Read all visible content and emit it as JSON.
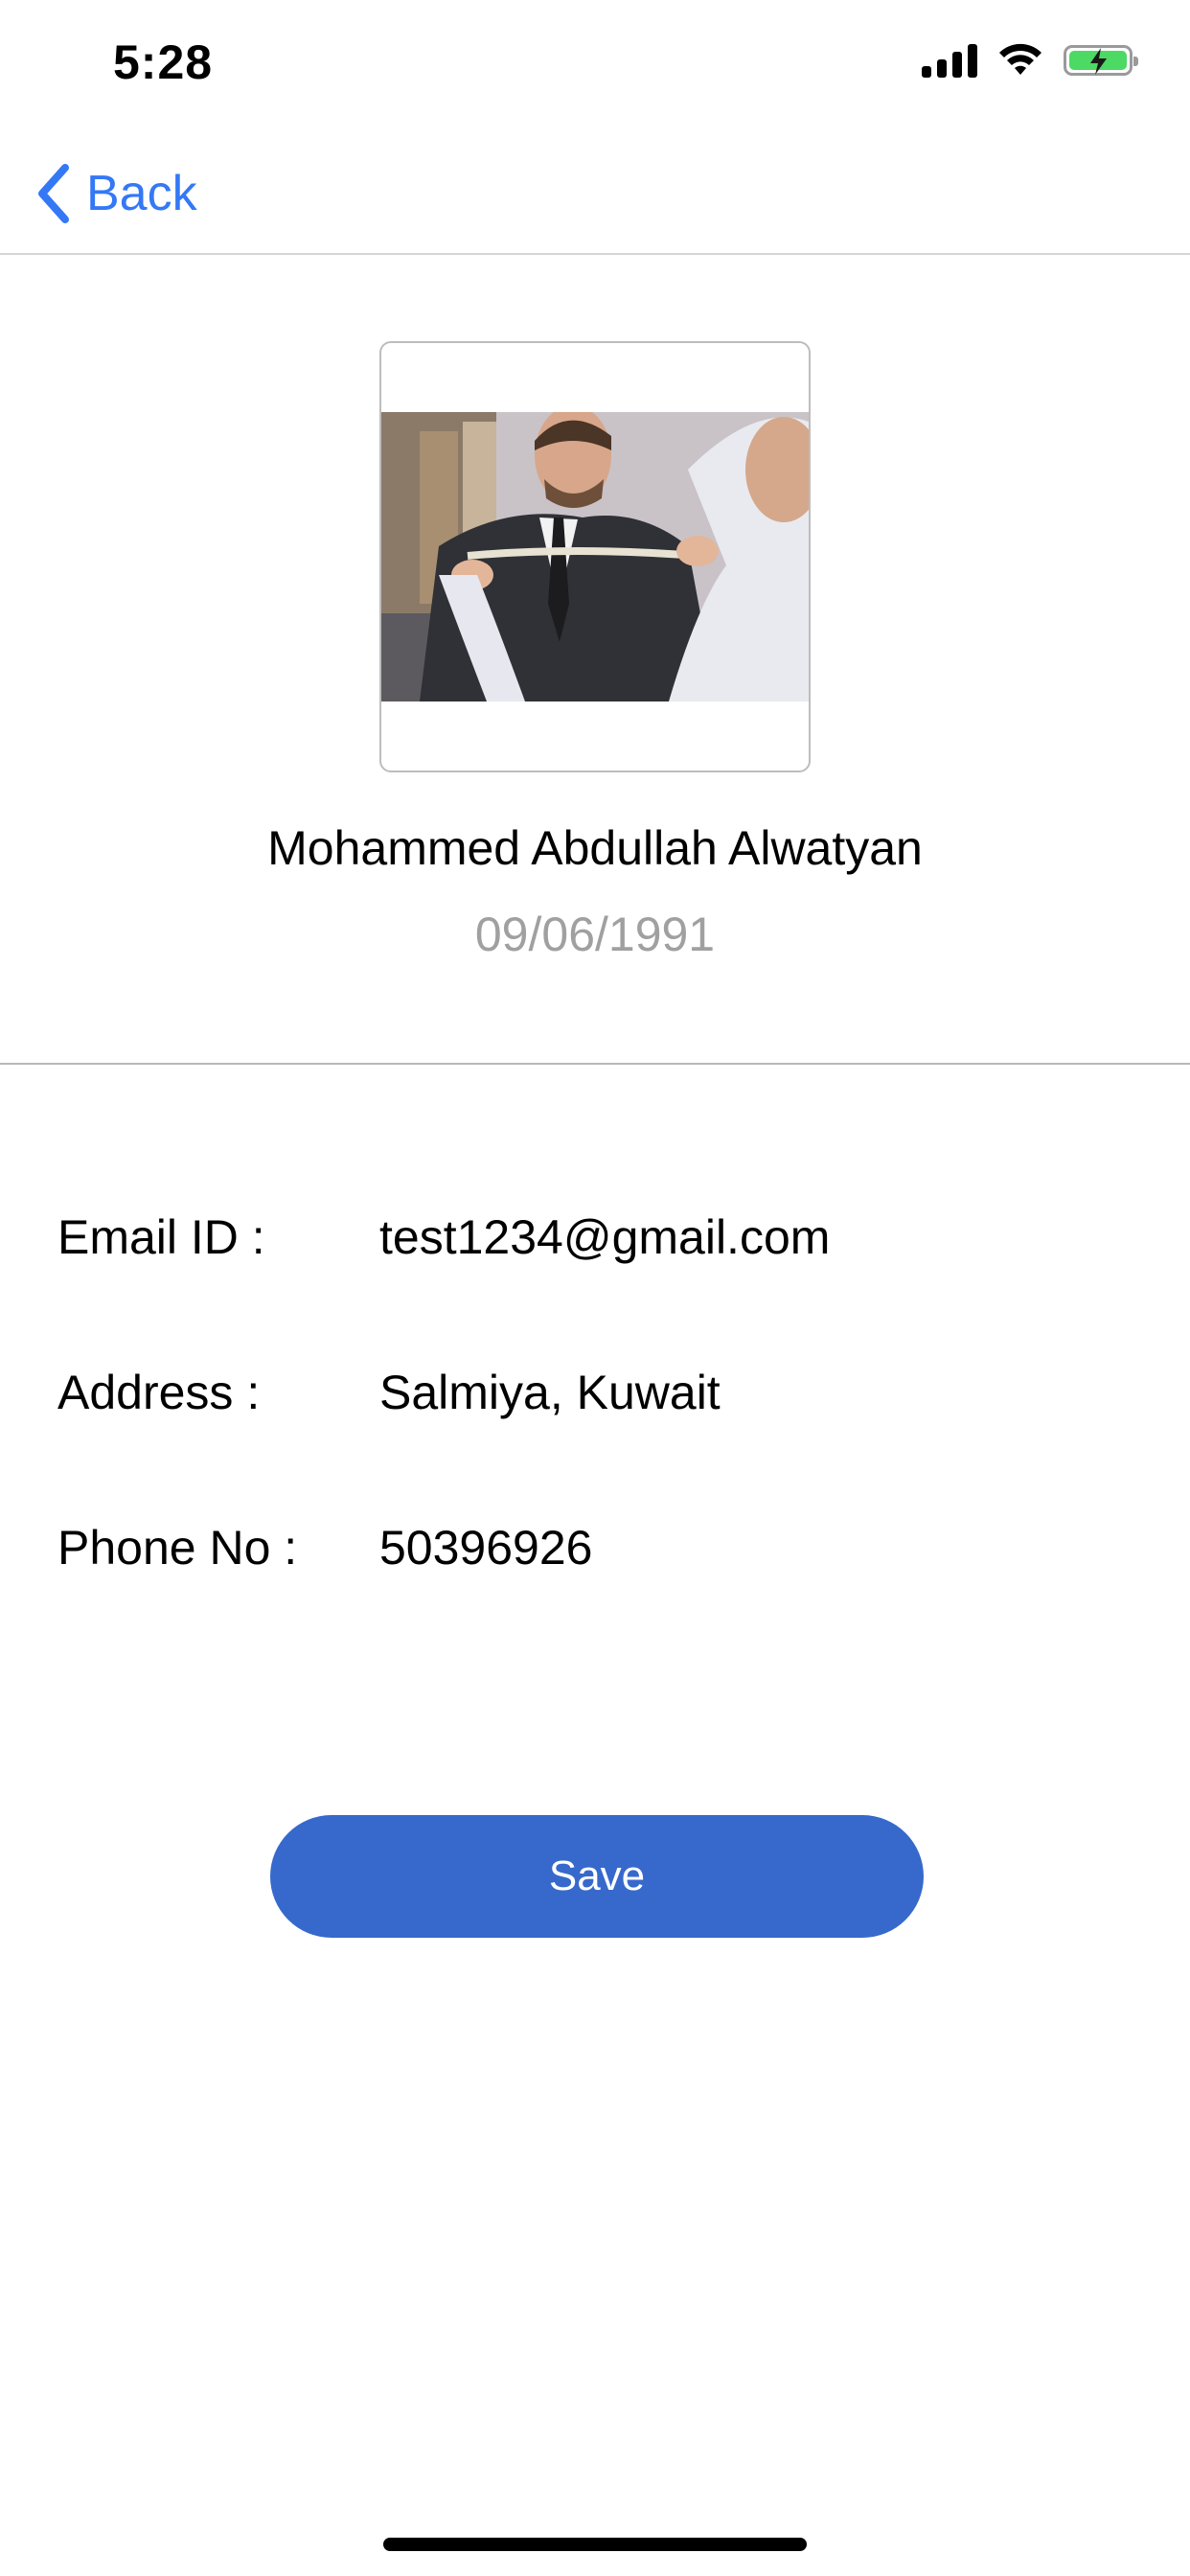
{
  "status_bar": {
    "time": "5:28",
    "icons": [
      "cellular-signal-icon",
      "wifi-icon",
      "battery-charging-icon"
    ],
    "battery_color": "#4cd964"
  },
  "nav": {
    "back_label": "Back",
    "back_icon": "chevron-left-icon",
    "accent_color": "#3478f6"
  },
  "profile": {
    "photo": "tailor-measuring-suit-photo",
    "name": "Mohammed Abdullah Alwatyan",
    "dob": "09/06/1991"
  },
  "details": [
    {
      "label": "Email ID :",
      "value": "test1234@gmail.com"
    },
    {
      "label": "Address :",
      "value": "Salmiya, Kuwait"
    },
    {
      "label": "Phone No :",
      "value": "50396926"
    }
  ],
  "actions": {
    "save_label": "Save",
    "save_color": "#3669cb"
  }
}
